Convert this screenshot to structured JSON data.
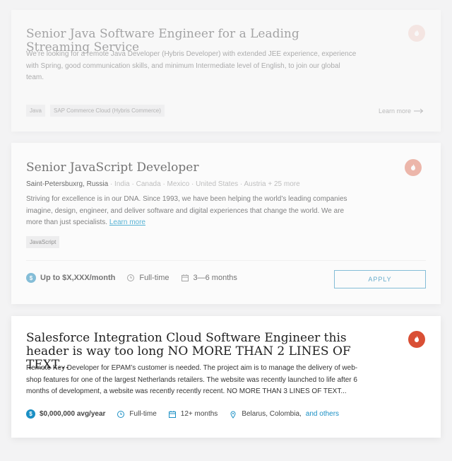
{
  "jobs": [
    {
      "title": "Senior Java Software Engineer for a Leading Streaming Service",
      "description": "We’re looking for a remote Java Developer (Hybris Developer) with extended JEE experience, experience with Spring, good communication skills, and minimum Intermediate level of English, to join our global team.",
      "tags": [
        "Java",
        "SAP Commerce Cloud (Hybris Commerce)"
      ],
      "learn_more": "Learn more",
      "flame_color": "#f3c0b4"
    },
    {
      "title": "Senior JavaScript Developer",
      "location_primary": "Saint-Petersbuxrg, Russia",
      "location_others": "· India · Canada · Mexico · United States · Austria + 25 more",
      "description": "Striving for excellence is in our DNA. Since 1993, we have been helping the world’s leading companies imagine, design, engineer, and deliver software and digital experiences that change the world. We are more than just specialists.",
      "desc_link": "Learn more",
      "tags": [
        "JavaScript"
      ],
      "salary": "Up to $X,XXX/month",
      "employment": "Full-time",
      "duration": "3—6 months",
      "apply_label": "APPLY",
      "flame_color": "#ea9f8e",
      "accent": "#2d8fbc"
    },
    {
      "title": "Salesforce Integration Cloud Software Engineer this header is way too long NO MORE THAN 2 LINES OF TEXT...",
      "description": "Remote Key Developer for EPAM’s customer is needed. The project aim is to manage the delivery of web-shop features for one of the largest Netherlands retailers. The website was recently launched to life after 6 months of development, a website was recently recently recent. NO MORE THAN 3 LINES OF TEXT...",
      "salary": "$0,000,000 avg/year",
      "employment": "Full-time",
      "duration": "12+ months",
      "location": "Belarus, Colombia,",
      "location_link": "and others",
      "flame_color": "#d94f35",
      "accent": "#1a8fc4"
    }
  ]
}
